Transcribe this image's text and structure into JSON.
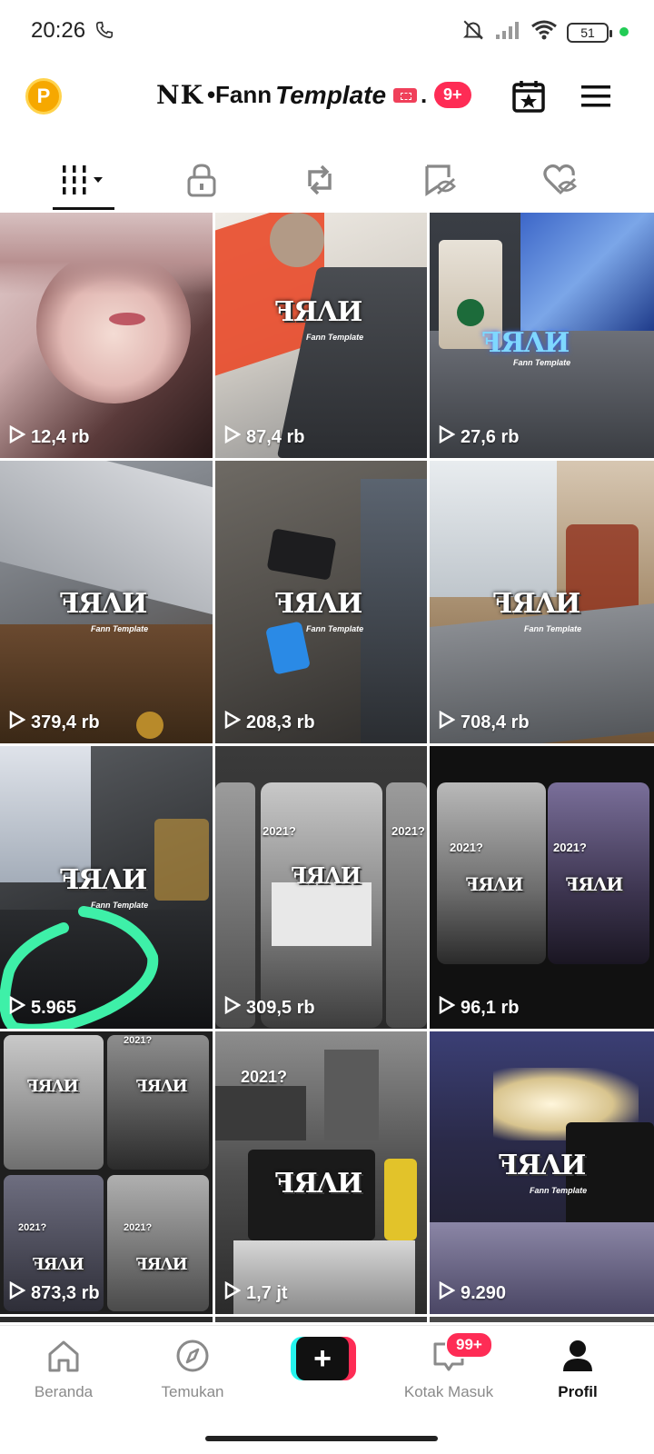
{
  "status_bar": {
    "time": "20:26",
    "battery": "51"
  },
  "header": {
    "points_badge": "P",
    "title_nk": "NK",
    "title_fann": "•Fann",
    "title_template": "Template",
    "title_dot": ".",
    "notification_count": "9+"
  },
  "tabs": [
    {
      "name": "videos",
      "icon": "grid-bars-icon",
      "active": true
    },
    {
      "name": "private",
      "icon": "lock-icon",
      "active": false
    },
    {
      "name": "reposts",
      "icon": "repost-icon",
      "active": false
    },
    {
      "name": "favorites",
      "icon": "bookmark-hidden-icon",
      "active": false
    },
    {
      "name": "liked",
      "icon": "heart-hidden-icon",
      "active": false
    }
  ],
  "videos": [
    {
      "views": "12,4 rb"
    },
    {
      "views": "87,4 rb"
    },
    {
      "views": "27,6 rb"
    },
    {
      "views": "379,4 rb"
    },
    {
      "views": "208,3 rb"
    },
    {
      "views": "708,4 rb"
    },
    {
      "views": "5.965"
    },
    {
      "views": "309,5 rb"
    },
    {
      "views": "96,1 rb"
    },
    {
      "views": "873,3 rb"
    },
    {
      "views": "1,7 jt"
    },
    {
      "views": "9.290"
    }
  ],
  "overlay_text": {
    "logo_sub": "Fann Template",
    "tag_year": "2021?"
  },
  "bottom_nav": {
    "home": "Beranda",
    "discover": "Temukan",
    "add": "+",
    "inbox": "Kotak Masuk",
    "inbox_badge": "99+",
    "profile": "Profil"
  },
  "colors": {
    "accent_red": "#fe2c55",
    "accent_cyan": "#25f4ee",
    "highlight_circle": "#3ef0a8",
    "points_orange": "#f6a800"
  }
}
